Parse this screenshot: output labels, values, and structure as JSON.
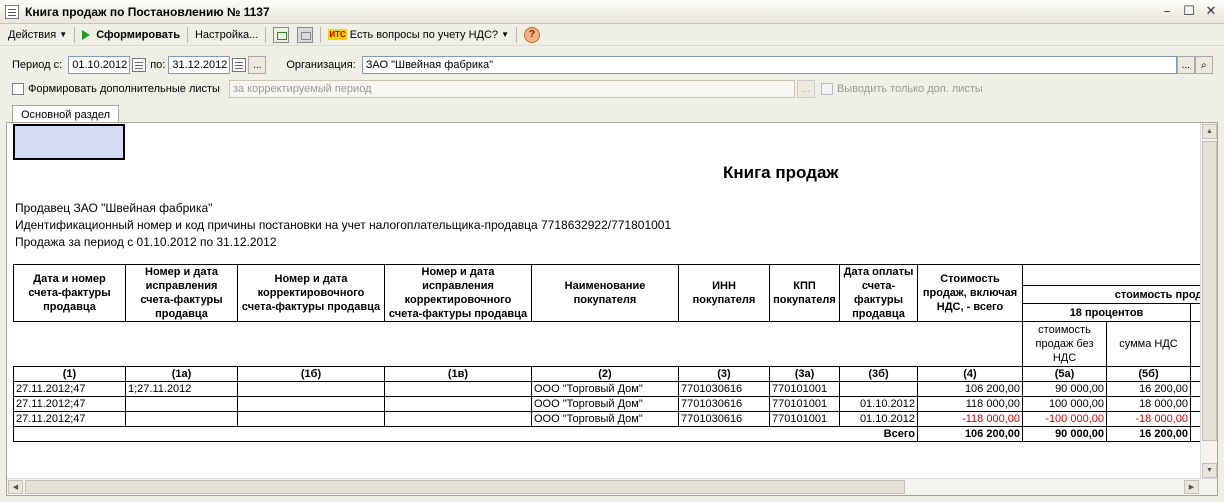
{
  "window": {
    "title": "Книга продаж по Постановлению № 1137"
  },
  "toolbar": {
    "actions_label": "Действия",
    "generate_label": "Сформировать",
    "settings_label": "Настройка...",
    "vat_help_prefix": "ИТС",
    "vat_help_label": "Есть вопросы по учету НДС?"
  },
  "period": {
    "from_label": "Период с:",
    "from_value": "01.10.2012",
    "to_label": "по:",
    "to_value": "31.12.2012",
    "org_label": "Организация:",
    "org_value": "ЗАО \"Швейная фабрика\""
  },
  "extra": {
    "checkbox_label": "Формировать дополнительные листы",
    "period_placeholder": "за корректируемый период",
    "only_extra_label": "Выводить только доп. листы"
  },
  "tabs": {
    "main": "Основной раздел"
  },
  "doc": {
    "title": "Книга продаж",
    "seller": "Продавец ЗАО \"Швейная фабрика\"",
    "inn_line": "Идентификационный номер и код причины постановки на учет налогоплательщика-продавца  7718632922/771801001",
    "period_line": "Продажа за период с 01.10.2012 по 31.12.2012",
    "headers": {
      "c1": "Дата и номер счета-фактуры продавца",
      "c1a": "Номер и дата исправления счета-фактуры продавца",
      "c1b": "Номер и дата корректировочного счета-фактуры продавца",
      "c1v": "Номер и дата исправления корректировочного счета-фактуры продавца",
      "c2": "Наименование покупателя",
      "c3": "ИНН покупателя",
      "c3a": "КПП покупателя",
      "c3b": "Дата оплаты счета-фактуры продавца",
      "c4": "Стоимость продаж, включая НДС, - всего",
      "group": "стоимость прода",
      "group18": "18 процентов",
      "c5a": "стоимость продаж без НДС",
      "c5b": "сумма НДС"
    },
    "numbers": {
      "c1": "(1)",
      "c1a": "(1а)",
      "c1b": "(1б)",
      "c1v": "(1в)",
      "c2": "(2)",
      "c3": "(3)",
      "c3a": "(3а)",
      "c3b": "(3б)",
      "c4": "(4)",
      "c5a": "(5а)",
      "c5b": "(5б)"
    },
    "rows": [
      {
        "c1": "27.11.2012;47",
        "c1a": "1;27.11.2012",
        "c1b": "",
        "c1v": "",
        "c2": "ООО \"Торговый Дом\"",
        "c3": "7701030616",
        "c3a": "770101001",
        "c3b": "",
        "c4": "106 200,00",
        "c5a": "90 000,00",
        "c5b": "16 200,00"
      },
      {
        "c1": "27.11.2012;47",
        "c1a": "",
        "c1b": "",
        "c1v": "",
        "c2": "ООО \"Торговый Дом\"",
        "c3": "7701030616",
        "c3a": "770101001",
        "c3b": "01.10.2012",
        "c4": "118 000,00",
        "c5a": "100 000,00",
        "c5b": "18 000,00"
      },
      {
        "c1": "27.11.2012;47",
        "c1a": "",
        "c1b": "",
        "c1v": "",
        "c2": "ООО \"Торговый Дом\"",
        "c3": "7701030616",
        "c3a": "770101001",
        "c3b": "01.10.2012",
        "c4": "-118 000,00",
        "c5a": "-100 000,00",
        "c5b": "-18 000,00"
      }
    ],
    "total": {
      "label": "Всего",
      "c4": "106 200,00",
      "c5a": "90 000,00",
      "c5b": "16 200,00"
    }
  }
}
